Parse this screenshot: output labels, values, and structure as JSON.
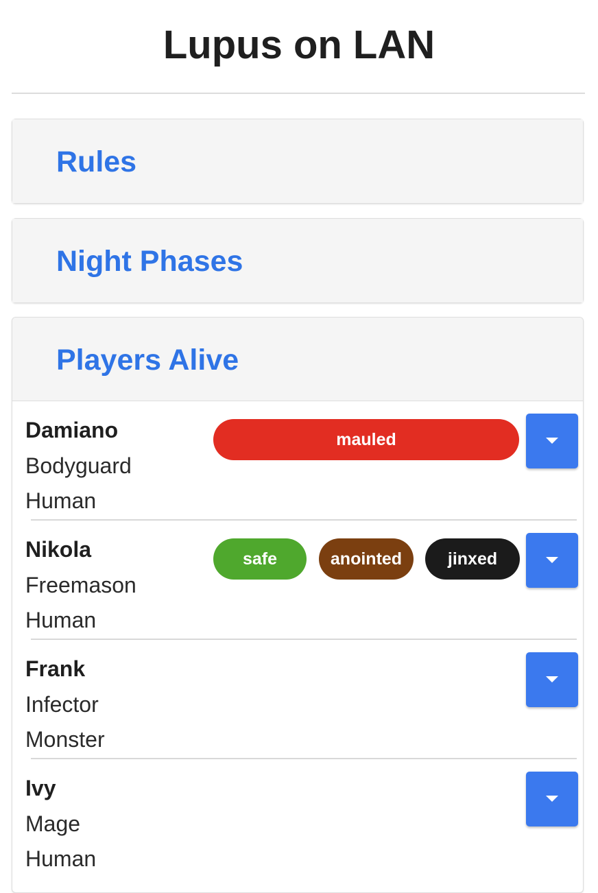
{
  "app": {
    "title": "Lupus on LAN"
  },
  "sections": {
    "rules": {
      "label": "Rules"
    },
    "night_phases": {
      "label": "Night Phases"
    },
    "players_alive": {
      "label": "Players Alive"
    }
  },
  "players": [
    {
      "name": "Damiano",
      "role": "Bodyguard",
      "team": "Human",
      "statuses": [
        {
          "label": "mauled",
          "color": "#e22d22"
        }
      ]
    },
    {
      "name": "Nikola",
      "role": "Freemason",
      "team": "Human",
      "statuses": [
        {
          "label": "safe",
          "color": "#4fa82d"
        },
        {
          "label": "anointed",
          "color": "#7b3f10"
        },
        {
          "label": "jinxed",
          "color": "#1b1b1b"
        }
      ]
    },
    {
      "name": "Frank",
      "role": "Infector",
      "team": "Monster",
      "statuses": []
    },
    {
      "name": "Ivy",
      "role": "Mage",
      "team": "Human",
      "statuses": []
    }
  ],
  "icons": {
    "dropdown": "caret-down-icon"
  },
  "colors": {
    "accent": "#2f74e6",
    "button": "#3b79ee"
  }
}
